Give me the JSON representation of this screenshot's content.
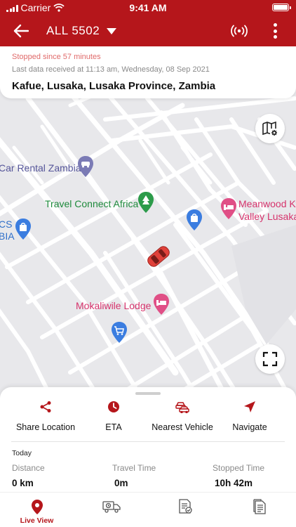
{
  "status_bar": {
    "carrier": "Carrier",
    "time": "9:41 AM"
  },
  "app_bar": {
    "vehicle_name": "ALL 5502"
  },
  "info": {
    "stopped_text": "Stopped since 57 minutes",
    "last_data": "Last data received at 11:13 am, Wednesday, 08 Sep 2021",
    "address": "Kafue, Lusaka, Lusaka Province, Zambia"
  },
  "map": {
    "pois": [
      {
        "label": "Car Rental Zambia",
        "color": "#555599",
        "icon": "car-rental-icon"
      },
      {
        "label": "Travel Connect Africa",
        "color": "#1e8a3c",
        "icon": "tree-icon"
      },
      {
        "label": "Meanwood Kw",
        "label2": "Valley Lusaka",
        "color": "#d6336c",
        "icon": "bed-icon"
      },
      {
        "label": "CS",
        "label2": "BIA",
        "color": "#2f6fc9",
        "icon": "shopping-bag-icon"
      },
      {
        "label": "Mokaliwile Lodge",
        "color": "#d6336c",
        "icon": "bed-icon"
      }
    ],
    "vehicle_color": "#e0413a"
  },
  "actions": [
    {
      "label": "Share Location",
      "icon": "share-icon"
    },
    {
      "label": "ETA",
      "icon": "clock-icon"
    },
    {
      "label": "Nearest Vehicle",
      "icon": "cars-icon"
    },
    {
      "label": "Navigate",
      "icon": "navigate-icon"
    }
  ],
  "stats": {
    "title": "Today",
    "items": [
      {
        "label": "Distance",
        "value": "0 km"
      },
      {
        "label": "Travel Time",
        "value": "0m"
      },
      {
        "label": "Stopped Time",
        "value": "10h 42m"
      }
    ]
  },
  "tabs": [
    {
      "label": "Live View",
      "icon": "location-pin-icon",
      "active": true
    },
    {
      "label": "",
      "icon": "truck-timer-icon"
    },
    {
      "label": "",
      "icon": "report-check-icon"
    },
    {
      "label": "",
      "icon": "document-icon"
    }
  ],
  "colors": {
    "primary": "#b5161b",
    "map_bg": "#e8e8eb",
    "road": "#ffffff"
  }
}
